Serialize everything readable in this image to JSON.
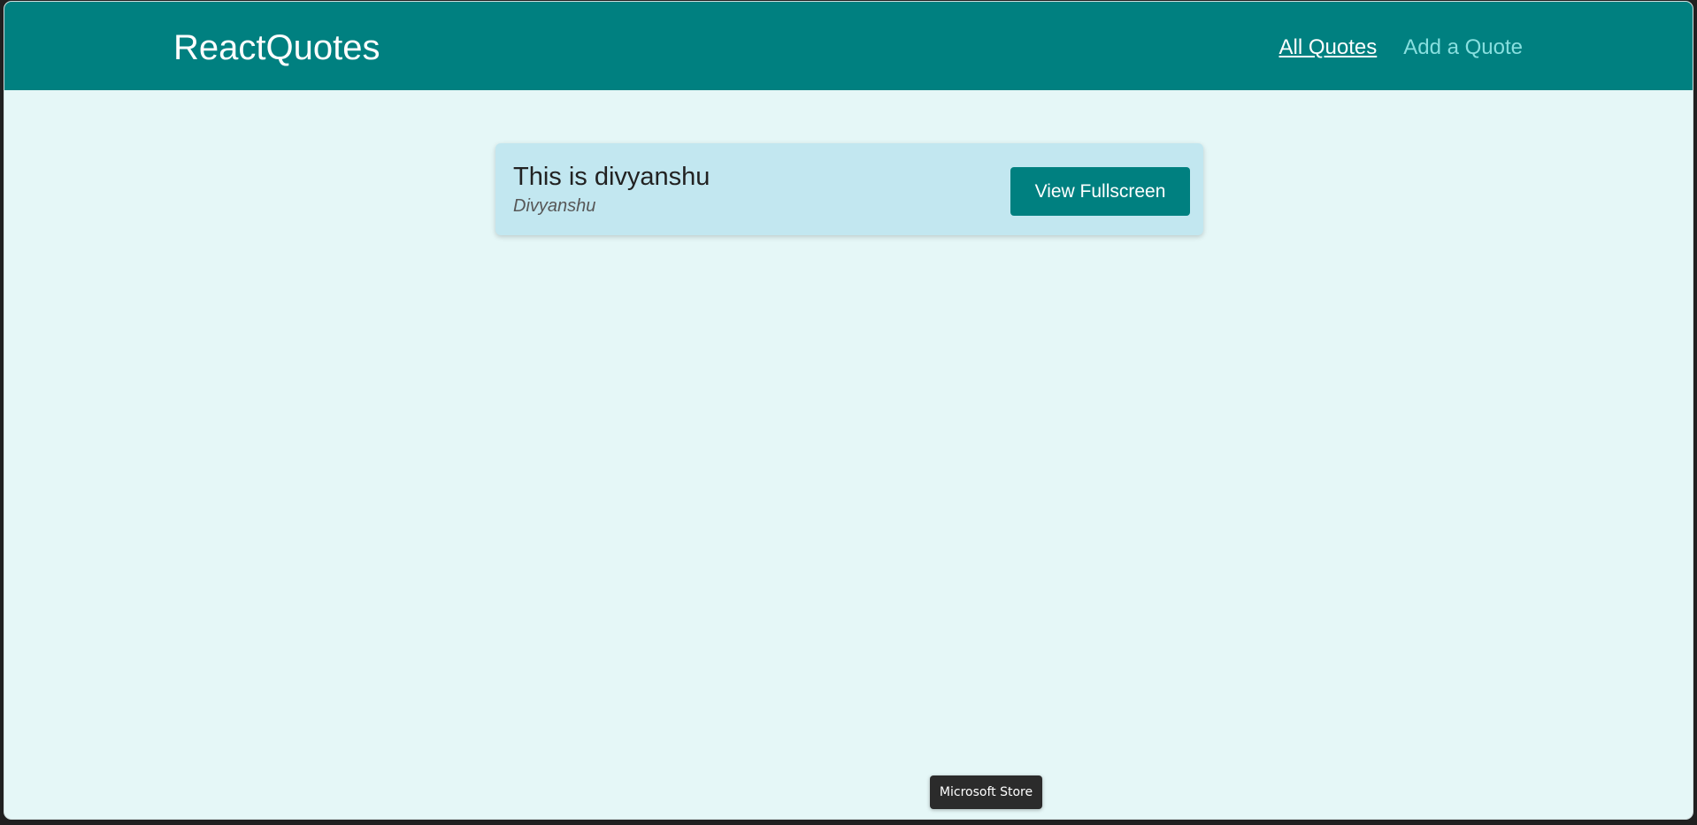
{
  "app": {
    "logo": "ReactQuotes"
  },
  "nav": {
    "items": [
      {
        "label": "All Quotes",
        "active": true
      },
      {
        "label": "Add a Quote",
        "active": false
      }
    ]
  },
  "quotes": [
    {
      "text": "This is divyanshu",
      "author": "Divyanshu",
      "button_label": "View Fullscreen"
    }
  ],
  "tooltip": {
    "text": "Microsoft Store"
  },
  "colors": {
    "header": "#008080",
    "page_background": "#e5f7f7",
    "card_background": "#c2e7f0",
    "button": "#008080",
    "nav_inactive": "#88dfdf"
  }
}
